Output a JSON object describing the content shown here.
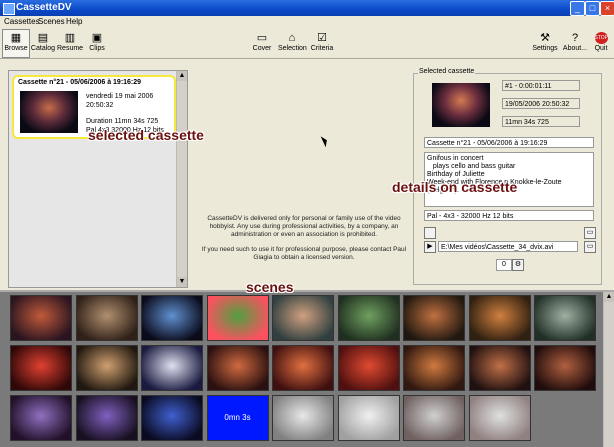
{
  "window": {
    "title": "CassetteDV"
  },
  "menu": [
    "Cassettes",
    "Scenes",
    "Help"
  ],
  "toolbar": {
    "left": [
      {
        "label": "Browse",
        "icon": "browse-icon",
        "active": true
      },
      {
        "label": "Catalog",
        "icon": "catalog-icon"
      },
      {
        "label": "Resume",
        "icon": "resume-icon"
      },
      {
        "label": "Clips",
        "icon": "clips-icon"
      }
    ],
    "center": [
      {
        "label": "Cover",
        "icon": "cover-icon"
      },
      {
        "label": "Selection",
        "icon": "selection-icon"
      },
      {
        "label": "Criteria",
        "icon": "criteria-icon"
      }
    ],
    "right": [
      {
        "label": "Settings",
        "icon": "settings-icon"
      },
      {
        "label": "About...",
        "icon": "about-icon"
      },
      {
        "label": "Quit",
        "icon": "stop-icon"
      }
    ]
  },
  "cassette_card": {
    "title": "Cassette n°21 - 05/06/2006 à 19:16:29",
    "date": "vendredi 19 mai 2006",
    "time": "20:50:32",
    "duration": "Duration 11mn 34s 725",
    "format": "Pal 4x3 32000 Hz 12 bits"
  },
  "annotations": {
    "selected": "selected cassette",
    "details": "details on cassette",
    "scenes": "scenes"
  },
  "notice": {
    "p1": "CassetteDV is delivered only for personal or family use of the video hobbyist. Any use during professional activities, by a company, an administration or even an association is prohibited.",
    "p2": "If you need such to use it for professional purpose, please contact Paul Giagia to obtain a licensed version."
  },
  "selected_cassette": {
    "group_label": "Selected cassette",
    "field1": "#1 - 0:00:01:11",
    "field2": "19/05/2006 20:50:32",
    "field3": "11mn 34s 725",
    "title": "Cassette n°21 - 05/06/2006 à 19:16:29",
    "description": [
      "Gnifous in concert",
      "   plays cello and bass guitar",
      "Birthday of Juliette",
      "Week-end with Florence n Knokke-le-Zoute (Belgium)."
    ],
    "format": "Pal - 4x3 - 32000 Hz 12 bits",
    "path": "E:\\Mes vidéos\\Cassette_34_dvix.avi",
    "counter": "0"
  },
  "scenes": [
    {
      "colors": [
        "#c05a3a",
        "#2a1420"
      ]
    },
    {
      "colors": [
        "#b09070",
        "#302018"
      ]
    },
    {
      "colors": [
        "#6090d0",
        "#0a0a1a"
      ]
    },
    {
      "colors": [
        "#50a040",
        "#ff5060"
      ]
    },
    {
      "colors": [
        "#d0a080",
        "#304040"
      ]
    },
    {
      "colors": [
        "#70a060",
        "#203020"
      ]
    },
    {
      "colors": [
        "#c07040",
        "#201810"
      ]
    },
    {
      "colors": [
        "#d08040",
        "#302010"
      ]
    },
    {
      "colors": [
        "#a0b0a0",
        "#203028"
      ]
    },
    {
      "colors": [
        "#e04030",
        "#300808"
      ]
    },
    {
      "colors": [
        "#d0a070",
        "#201810"
      ]
    },
    {
      "colors": [
        "#e0e0f0",
        "#1a1a40"
      ]
    },
    {
      "colors": [
        "#d06a40",
        "#2a1010"
      ]
    },
    {
      "colors": [
        "#e07040",
        "#401010"
      ]
    },
    {
      "colors": [
        "#e04a30",
        "#501010"
      ]
    },
    {
      "colors": [
        "#d07a40",
        "#301810"
      ]
    },
    {
      "colors": [
        "#c07048",
        "#201010"
      ]
    },
    {
      "colors": [
        "#b06040",
        "#200c0c"
      ]
    },
    {
      "colors": [
        "#9070c0",
        "#201028"
      ]
    },
    {
      "colors": [
        "#8060c0",
        "#181020"
      ]
    },
    {
      "colors": [
        "#4060d0",
        "#0a0a20"
      ]
    },
    {
      "colors": [
        "#0018ff",
        "#0018ff"
      ],
      "text": "0mn 3s"
    },
    {
      "colors": [
        "#e8e8e8",
        "#808080"
      ]
    },
    {
      "colors": [
        "#f0f0f0",
        "#a0a0a0"
      ]
    },
    {
      "colors": [
        "#d0d0d0",
        "#706060"
      ]
    },
    {
      "colors": [
        "#e0e0e0",
        "#908080"
      ]
    }
  ]
}
